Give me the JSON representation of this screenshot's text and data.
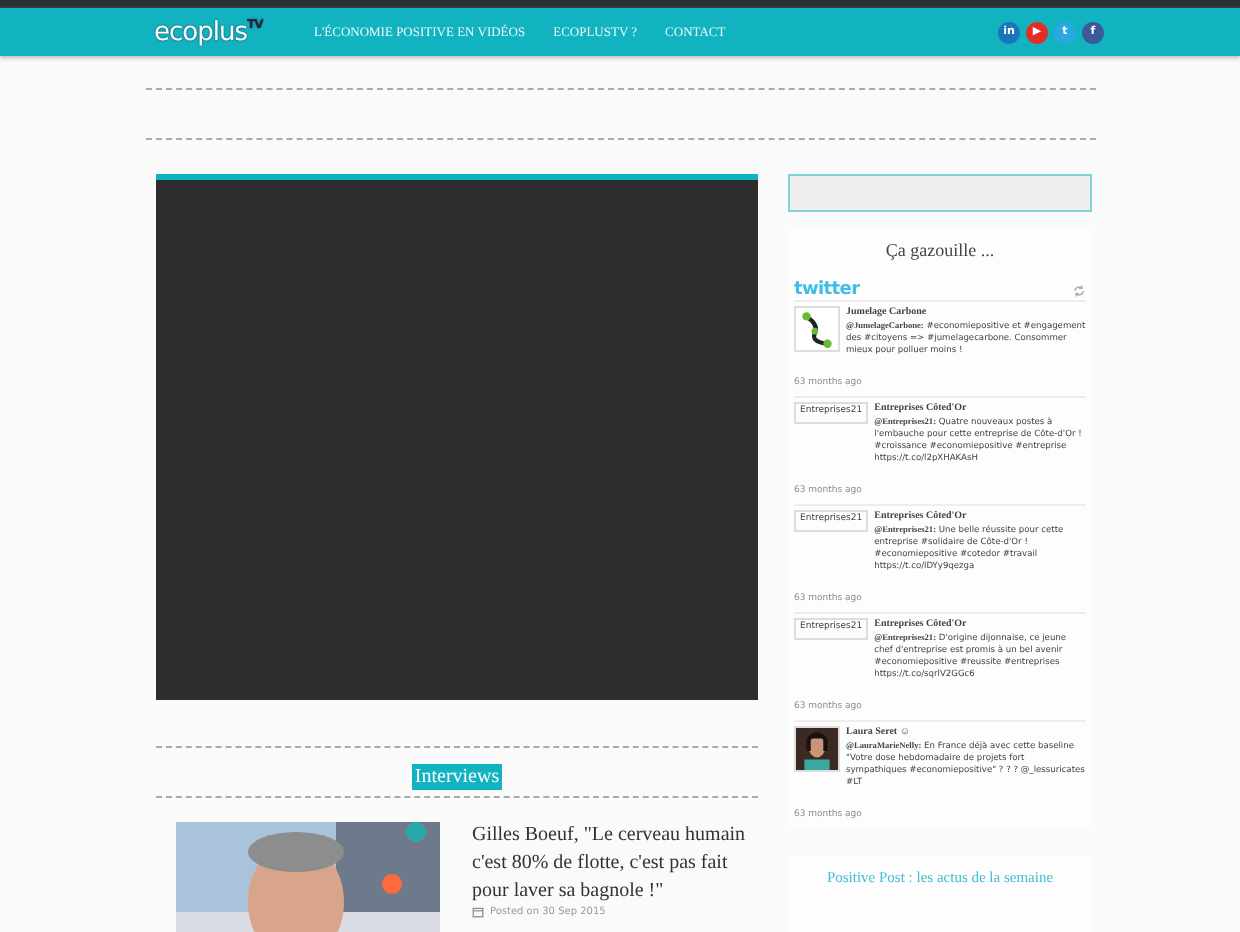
{
  "header": {
    "logo": "ecoplus",
    "logo_sup": "TV",
    "nav": [
      {
        "label": "L'ÉCONOMIE POSITIVE EN VIDÉOS"
      },
      {
        "label": "ECOPLUSTV ?"
      },
      {
        "label": "CONTACT"
      }
    ],
    "social": [
      {
        "label": "in",
        "color": "#1b75bb"
      },
      {
        "label": "▶",
        "color": "#e52d27"
      },
      {
        "label": "t",
        "color": "#28a9e0"
      },
      {
        "label": "f",
        "color": "#3b5998"
      }
    ]
  },
  "video": {
    "kind": "player"
  },
  "section": {
    "title": "Interviews"
  },
  "article": {
    "title": "Gilles Boeuf, \"Le cerveau humain c'est 80% de flotte, c'est pas fait pour laver sa bagnole !\"",
    "meta": "Posted on 30 Sep 2015"
  },
  "sidebar": {
    "widget_title": "Ça gazouille ...",
    "twitter_logo": "twitter",
    "tweets": [
      {
        "name": "Jumelage Carbone",
        "text": "**@JumelageCarbone:** #economiepositive et #engagement des #citoyens => #jumelagecarbone. Consommer mieux pour polluer moins !",
        "time": "63 months ago"
      },
      {
        "avatar": {
          "kind": "broken",
          "alt": "Entreprises21"
        },
        "name": "Entreprises Côted'Or",
        "text": "**@Entreprises21:** Quatre nouveaux postes à l'embauche pour cette entreprise de Côte-d'Or ! #croissance #economiepositive #entreprise https://t.co/l2pXHAKAsH",
        "time": "63 months ago"
      },
      {
        "avatar": {
          "kind": "broken",
          "alt": "Entreprises21"
        },
        "name": "Entreprises Côted'Or",
        "text": "**@Entreprises21:** Une belle réussite pour cette entreprise #solidaire de Côte-d'Or ! #economiepositive #cotedor #travail https://t.co/lDYy9qezga",
        "time": "63 months ago"
      },
      {
        "avatar": {
          "kind": "broken",
          "alt": "Entreprises21"
        },
        "name": "Entreprises Côted'Or",
        "text": "**@Entreprises21:** D'origine dijonnaise, ce jeune chef d'entreprise est promis à un bel avenir #economiepositive #reussite #entreprises https://t.co/sqrlV2GGc6",
        "time": "63 months ago"
      },
      {
        "name": "Laura Seret ☺",
        "text": "**@LauraMarieNelly:** En France déjà avec cette baseline \"Votre dose hebdomadaire de projets fort sympathiques #economiepositive\" ? ? ? @_lessuricates #LT",
        "time": "63 months ago"
      }
    ],
    "next_title": "Positive Post : les actus de la semaine"
  }
}
